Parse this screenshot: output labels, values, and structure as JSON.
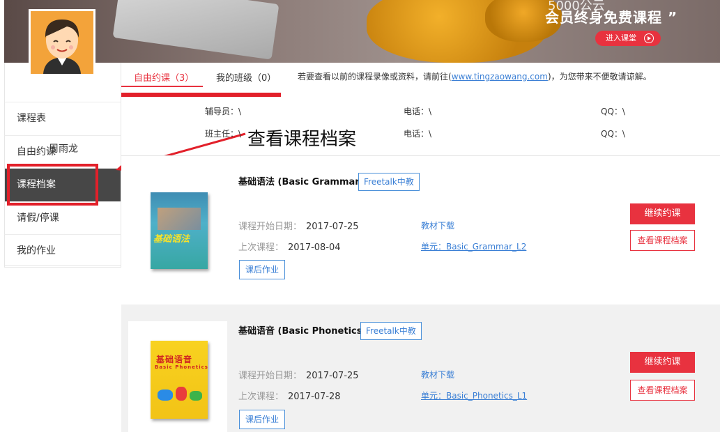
{
  "banner": {
    "top_text": "5000公云",
    "title": "会员终身免费课程 ”",
    "enter_button": "进入课堂"
  },
  "user": {
    "name": "周雨龙"
  },
  "sidebar": {
    "items": [
      {
        "label": "课程表"
      },
      {
        "label": "自由约课"
      },
      {
        "label": "课程档案"
      },
      {
        "label": "请假/停课"
      },
      {
        "label": "我的作业"
      }
    ],
    "active_index": 2
  },
  "tabs": [
    {
      "label": "自由约课（3）"
    },
    {
      "label": "我的班级（0）"
    }
  ],
  "notice": {
    "before": "若要查看以前的课程录像或资料，请前往(",
    "link": "www.tingzaowang.com",
    "after": ")，为您带来不便敬请谅解。"
  },
  "contacts": {
    "tutor": "辅导员：\\",
    "tutor_phone": "电话：\\",
    "tutor_qq": "QQ：\\",
    "teacher": "班主任：\\",
    "teacher_phone": "电话：\\",
    "teacher_qq": "QQ：\\"
  },
  "annotation_caption": "查看课程档案",
  "courses": [
    {
      "title": "基础语法 (Basic Grammar)",
      "badge": "Freetalk中教",
      "cover_text": "基础语法",
      "start_label": "课程开始日期：",
      "start_date": "2017-07-25",
      "last_label": "上次课程：",
      "last_date": "2017-08-04",
      "download": "教材下载",
      "unit": "单元：Basic_Grammar_L2",
      "homework": "课后作业",
      "continue": "继续约课",
      "view": "查看课程档案"
    },
    {
      "title": "基础语音 (Basic Phonetics)",
      "badge": "Freetalk中教",
      "cover_text": "基础语音",
      "cover_sub": "Basic Phonetics",
      "start_label": "课程开始日期：",
      "start_date": "2017-07-25",
      "last_label": "上次课程：",
      "last_date": "2017-07-28",
      "download": "教材下载",
      "unit": "单元：Basic_Phonetics_L1",
      "homework": "课后作业",
      "continue": "继续约课",
      "view": "查看课程档案"
    }
  ],
  "colors": {
    "accent": "#e8323f",
    "link": "#3a7fd5",
    "active_bg": "#474747",
    "annotation": "#e2202a"
  }
}
